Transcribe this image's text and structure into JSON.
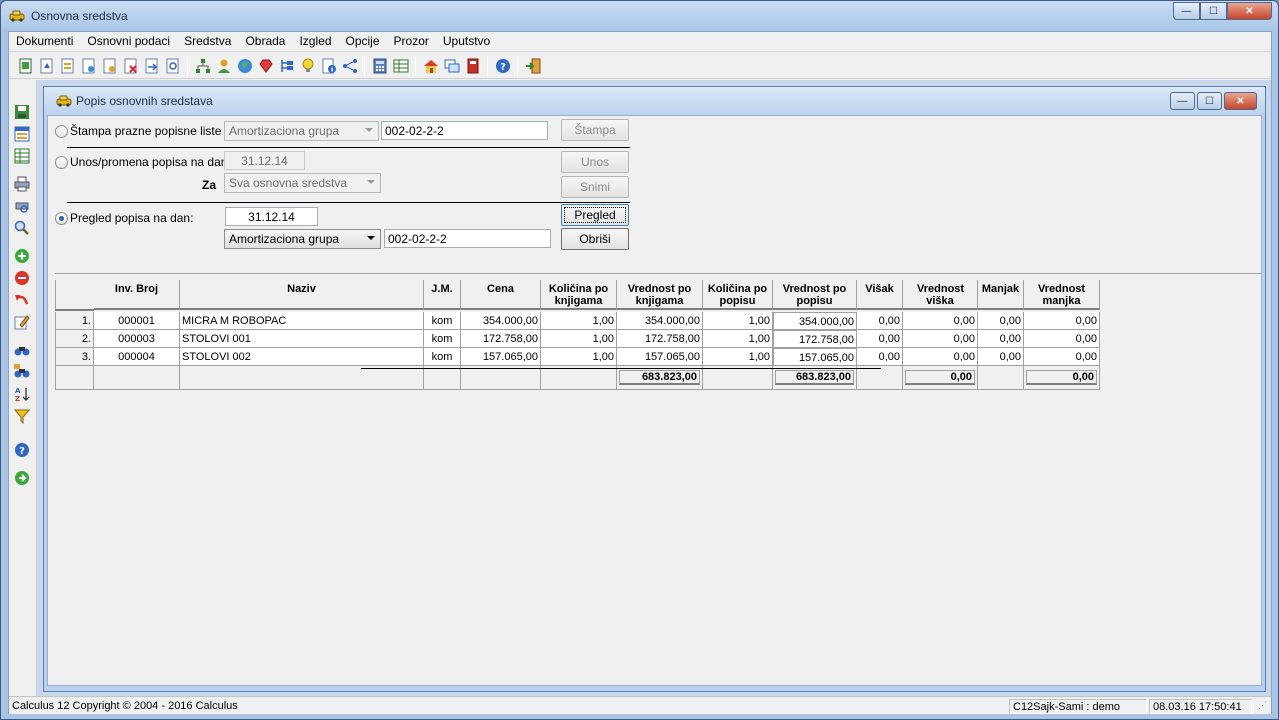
{
  "app": {
    "title": "Osnovna sredstva",
    "menu": [
      "Dokumenti",
      "Osnovni podaci",
      "Sredstva",
      "Obrada",
      "Izgled",
      "Opcije",
      "Prozor",
      "Uputstvo"
    ],
    "win_buttons": {
      "min": "—",
      "max": "☐",
      "close": "✕"
    }
  },
  "child": {
    "title": "Popis osnovnih sredstava"
  },
  "form": {
    "print_empty": {
      "label": "Štampa prazne popisne liste po:",
      "combo": "Amortizaciona grupa",
      "code": "002-02-2-2",
      "button": "Štampa"
    },
    "entry": {
      "label": "Unos/promena popisa na dan:",
      "date": "31.12.14",
      "for_label": "Za",
      "combo": "Sva osnovna sredstva",
      "btn_unos": "Unos",
      "btn_snimi": "Snimi"
    },
    "review": {
      "label": "Pregled popisa na dan:",
      "date": "31.12.14",
      "combo": "Amortizaciona grupa",
      "code": "002-02-2-2",
      "btn_pregled": "Pregled",
      "btn_obrisi": "Obriši"
    }
  },
  "grid": {
    "headers": [
      "Inv. Broj",
      "Naziv",
      "J.M.",
      "Cena",
      "Količina po knjigama",
      "Vrednost po knjigama",
      "Količina po popisu",
      "Vrednost po popisu",
      "Višak",
      "Vrednost viška",
      "Manjak",
      "Vrednost manjka"
    ],
    "rows": [
      {
        "n": "1.",
        "inv": "000001",
        "naziv": "MICRA M ROBOPAC",
        "jm": "kom",
        "cena": "354.000,00",
        "kol_knj": "1,00",
        "vr_knj": "354.000,00",
        "kol_pop": "1,00",
        "vr_pop": "354.000,00",
        "visak": "0,00",
        "vr_visak": "0,00",
        "manjak": "0,00",
        "vr_manjak": "0,00"
      },
      {
        "n": "2.",
        "inv": "000003",
        "naziv": "STOLOVI 001",
        "jm": "kom",
        "cena": "172.758,00",
        "kol_knj": "1,00",
        "vr_knj": "172.758,00",
        "kol_pop": "1,00",
        "vr_pop": "172.758,00",
        "visak": "0,00",
        "vr_visak": "0,00",
        "manjak": "0,00",
        "vr_manjak": "0,00"
      },
      {
        "n": "3.",
        "inv": "000004",
        "naziv": "STOLOVI 002",
        "jm": "kom",
        "cena": "157.065,00",
        "kol_knj": "1,00",
        "vr_knj": "157.065,00",
        "kol_pop": "1,00",
        "vr_pop": "157.065,00",
        "visak": "0,00",
        "vr_visak": "0,00",
        "manjak": "0,00",
        "vr_manjak": "0,00"
      }
    ],
    "totals": {
      "vr_knj": "683.823,00",
      "vr_pop": "683.823,00",
      "vr_visak": "0,00",
      "vr_manjak": "0,00"
    }
  },
  "status": {
    "copyright": "Calculus 12  Copyright © 2004 - 2016  Calculus",
    "user": "C12Sajk-Sami : demo",
    "datetime": "08.03.16 17:50:41"
  }
}
